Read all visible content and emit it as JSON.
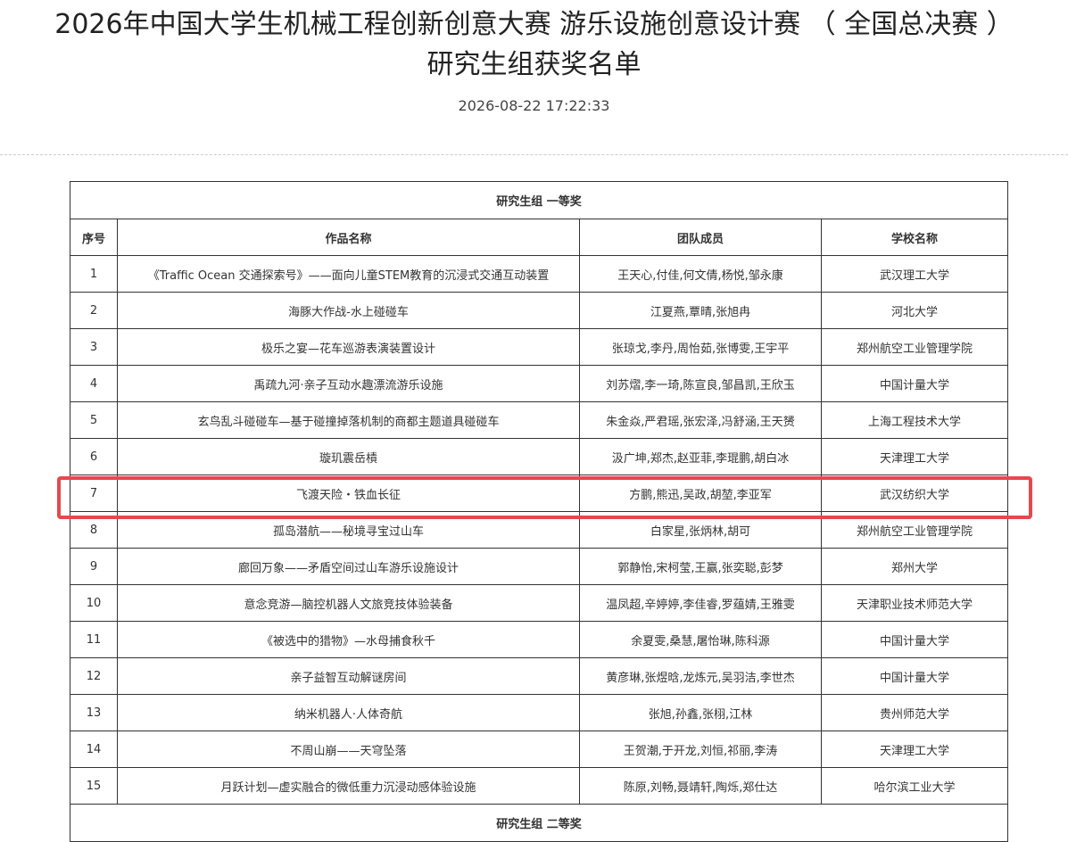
{
  "article": {
    "title_line1": "2026年中国大学生机械工程创新创意大赛 游乐设施创意设计赛 （ 全国总决赛 ）",
    "title_line2": "研究生组获奖名单",
    "timestamp": "2026-08-22 17:22:33"
  },
  "table": {
    "section_title": "研究生组 一等奖",
    "headers": [
      "序号",
      "作品名称",
      "团队成员",
      "学校名称"
    ],
    "rows": [
      [
        "1",
        "《Traffic Ocean 交通探索号》——面向儿童STEM教育的沉浸式交通互动装置",
        "王天心,付佳,何文倩,杨悦,邹永康",
        "武汉理工大学"
      ],
      [
        "2",
        "海豚大作战-水上碰碰车",
        "江夏燕,覃晴,张旭冉",
        "河北大学"
      ],
      [
        "3",
        "极乐之宴—花车巡游表演装置设计",
        "张琼戈,李丹,周怡茹,张博雯,王宇平",
        "郑州航空工业管理学院"
      ],
      [
        "4",
        "禹疏九河·亲子互动水趣漂流游乐设施",
        "刘苏熠,李一琦,陈宣良,邹昌凯,王欣玉",
        "中国计量大学"
      ],
      [
        "5",
        "玄鸟乱斗碰碰车—基于碰撞掉落机制的商都主题道具碰碰车",
        "朱金焱,严君瑶,张宏泽,冯舒涵,王天赟",
        "上海工程技术大学"
      ],
      [
        "6",
        "璇玑震岳樍",
        "汲广坤,郑杰,赵亚菲,李琨鹏,胡白冰",
        "天津理工大学"
      ],
      [
        "7",
        "飞渡天险・铁血长征",
        "方鹏,熊迅,吴政,胡堃,李亚军",
        "武汉纺织大学"
      ],
      [
        "8",
        "孤岛潜航——秘境寻宝过山车",
        "白家星,张炳林,胡可",
        "郑州航空工业管理学院"
      ],
      [
        "9",
        "廊回万象——矛盾空间过山车游乐设施设计",
        "郭静怡,宋柯莹,王赢,张奕聪,彭梦",
        "郑州大学"
      ],
      [
        "10",
        "意念竞游—脑控机器人文旅竞技体验装备",
        "温凤超,辛婷婷,李佳睿,罗蕴婧,王雅雯",
        "天津职业技术师范大学"
      ],
      [
        "11",
        "《被选中的猎物》—水母捕食秋千",
        "余夏雯,桑慧,屠怡琳,陈科源",
        "中国计量大学"
      ],
      [
        "12",
        "亲子益智互动解谜房间",
        "黄彦琳,张煜晗,龙炼元,吴羽洁,李世杰",
        "中国计量大学"
      ],
      [
        "13",
        "纳米机器人·人体奇航",
        "张旭,孙鑫,张栩,江林",
        "贵州师范大学"
      ],
      [
        "14",
        "不周山崩——天穹坠落",
        "王贺潮,于开龙,刘恒,祁丽,李涛",
        "天津理工大学"
      ],
      [
        "15",
        "月跃计划—虚实融合的微低重力沉浸动感体验设施",
        "陈原,刘畅,聂靖轩,陶烁,郑仕达",
        "哈尔滨工业大学"
      ]
    ],
    "next_section_title": "研究生组 二等奖",
    "highlighted_row": "7"
  },
  "colors": {
    "highlight": "#e8474f",
    "border": "#333333",
    "text": "#333333"
  }
}
